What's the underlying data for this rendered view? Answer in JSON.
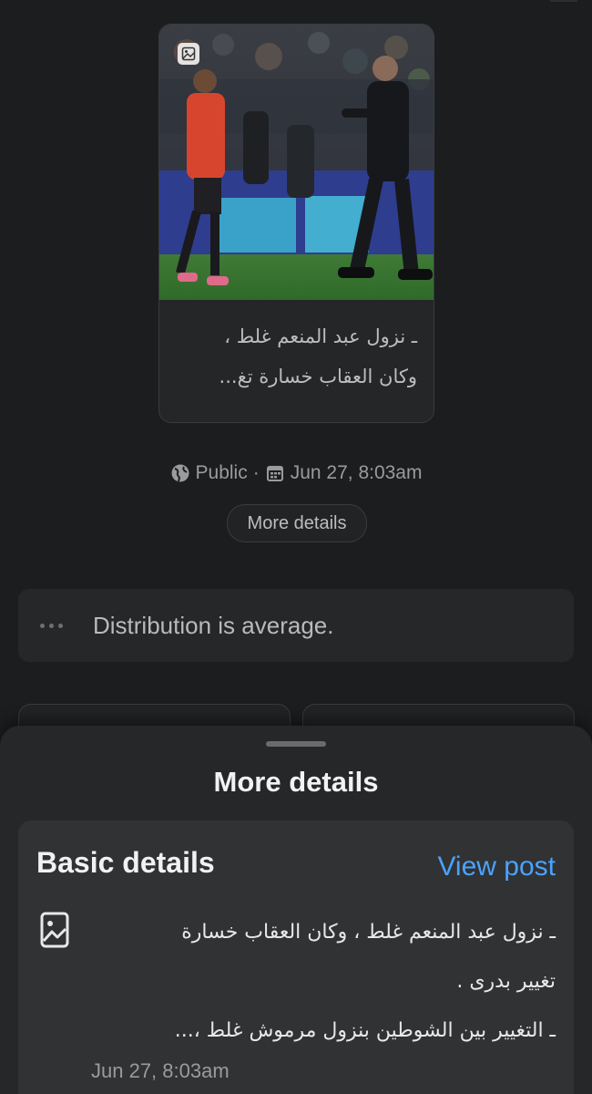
{
  "post": {
    "caption_lines": [
      "ـ نزول عبد المنعم غلط ،",
      "وكان العقاب خسارة تغ..."
    ],
    "media_icon": "image-icon"
  },
  "meta": {
    "visibility_icon": "globe-icon",
    "visibility": "Public",
    "separator": "·",
    "date_icon": "calendar-icon",
    "date": "Jun 27, 8:03am"
  },
  "more_details_button": "More details",
  "distribution": {
    "icon": "more-dots-icon",
    "text": "Distribution is average."
  },
  "sheet": {
    "title": "More details",
    "basic_details": {
      "heading": "Basic details",
      "view_post_label": "View post",
      "icon": "photo-icon",
      "text_lines": [
        "ـ نزول عبد المنعم غلط ، وكان العقاب خسارة",
        "تغيير بدرى .",
        "ـ التغيير بين الشوطين بنزول مرموش غلط ،..."
      ],
      "date": "Jun 27, 8:03am"
    }
  },
  "colors": {
    "background": "#1c1d1f",
    "sheet": "#262729",
    "card": "#313234",
    "link": "#4aa3ff",
    "muted_text": "#9a9b9d"
  }
}
